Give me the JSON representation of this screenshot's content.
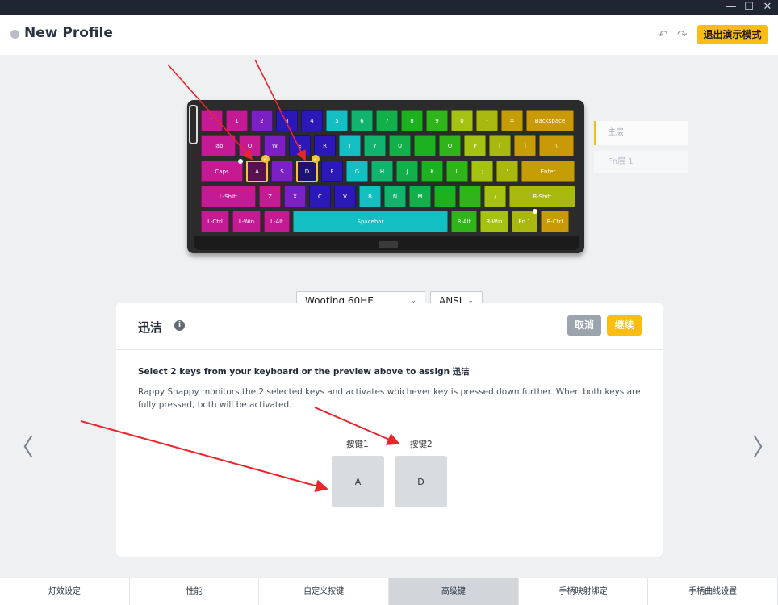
{
  "window": {
    "minimize": "—",
    "maximize": "☐",
    "close": "✕"
  },
  "header": {
    "title": "New Profile",
    "undo_icon": "↶",
    "redo_icon": "↷",
    "exit_demo_label": "退出演示模式"
  },
  "keyboard": {
    "rows": [
      [
        {
          "label": "`",
          "color": "#c41b95"
        },
        {
          "label": "1",
          "color": "#c41b95"
        },
        {
          "label": "2",
          "color": "#7a20c4"
        },
        {
          "label": "3",
          "color": "#2b18b8"
        },
        {
          "label": "4",
          "color": "#2b18b8"
        },
        {
          "label": "5",
          "color": "#14bfc4"
        },
        {
          "label": "6",
          "color": "#11b46c"
        },
        {
          "label": "7",
          "color": "#12b04a"
        },
        {
          "label": "8",
          "color": "#1cb21f"
        },
        {
          "label": "9",
          "color": "#2fb51a"
        },
        {
          "label": "0",
          "color": "#a5c213"
        },
        {
          "label": "-",
          "color": "#a8b80f"
        },
        {
          "label": "=",
          "color": "#c59d07"
        },
        {
          "label": "Backspace",
          "color": "#c99908"
        }
      ],
      [
        {
          "label": "Tab",
          "color": "#c41b95"
        },
        {
          "label": "Q",
          "color": "#c41b95"
        },
        {
          "label": "W",
          "color": "#7a20c4"
        },
        {
          "label": "E",
          "color": "#2b18b8"
        },
        {
          "label": "R",
          "color": "#2b18b8"
        },
        {
          "label": "T",
          "color": "#14bfc4"
        },
        {
          "label": "Y",
          "color": "#11b46c"
        },
        {
          "label": "U",
          "color": "#12b04a"
        },
        {
          "label": "I",
          "color": "#1cb21f"
        },
        {
          "label": "O",
          "color": "#2fb51a"
        },
        {
          "label": "P",
          "color": "#a5c213"
        },
        {
          "label": "[",
          "color": "#a8b80f"
        },
        {
          "label": "]",
          "color": "#c59d07"
        },
        {
          "label": "\\",
          "color": "#c99908"
        }
      ],
      [
        {
          "label": "Caps",
          "color": "#c41b95"
        },
        {
          "label": "A",
          "color": "#c41b95"
        },
        {
          "label": "S",
          "color": "#7a20c4"
        },
        {
          "label": "D",
          "color": "#2b18b8"
        },
        {
          "label": "F",
          "color": "#2b18b8"
        },
        {
          "label": "G",
          "color": "#14bfc4"
        },
        {
          "label": "H",
          "color": "#11b46c"
        },
        {
          "label": "J",
          "color": "#12b04a"
        },
        {
          "label": "K",
          "color": "#1cb21f"
        },
        {
          "label": "L",
          "color": "#2fb51a"
        },
        {
          "label": ";",
          "color": "#a5c213"
        },
        {
          "label": "'",
          "color": "#a8b80f"
        },
        {
          "label": "Enter",
          "color": "#c59d07"
        }
      ],
      [
        {
          "label": "L-Shift",
          "color": "#c41b95"
        },
        {
          "label": "Z",
          "color": "#c41b95"
        },
        {
          "label": "X",
          "color": "#7a20c4"
        },
        {
          "label": "C",
          "color": "#2b18b8"
        },
        {
          "label": "V",
          "color": "#2b18b8"
        },
        {
          "label": "B",
          "color": "#14bfc4"
        },
        {
          "label": "N",
          "color": "#11b46c"
        },
        {
          "label": "M",
          "color": "#12b04a"
        },
        {
          "label": ",",
          "color": "#1cb21f"
        },
        {
          "label": ".",
          "color": "#2fb51a"
        },
        {
          "label": "/",
          "color": "#a5c213"
        },
        {
          "label": "R-Shift",
          "color": "#a8b80f"
        }
      ],
      [
        {
          "label": "L-Ctrl",
          "color": "#c41b95"
        },
        {
          "label": "L-Win",
          "color": "#c41b95"
        },
        {
          "label": "L-Alt",
          "color": "#c41b95"
        },
        {
          "label": "Spacebar",
          "color": "#14bfc4"
        },
        {
          "label": "R-Alt",
          "color": "#2fb51a"
        },
        {
          "label": "R-Win",
          "color": "#a5c213"
        },
        {
          "label": "Fn 1",
          "color": "#a8b80f"
        },
        {
          "label": "R-Ctrl",
          "color": "#c99908"
        }
      ]
    ],
    "selected_keys": [
      "A",
      "D"
    ]
  },
  "layers": {
    "main": "主层",
    "fn": "Fn层 1"
  },
  "selectors": {
    "model": "Wooting 60HE",
    "layout": "ANSI"
  },
  "panel": {
    "title": "迅洁",
    "cancel": "取消",
    "continue": "继续",
    "instruction": "Select 2 keys from your keyboard or the preview above to assign 迅洁",
    "description": "Rappy Snappy monitors the 2 selected keys and activates whichever key is pressed down further. When both keys are fully pressed, both will be activated.",
    "slot1_label": "按键1",
    "slot2_label": "按键2",
    "slot1_value": "A",
    "slot2_value": "D"
  },
  "nav": {
    "prev": "〈",
    "next": "〉"
  },
  "bottom_tabs": [
    "灯效设定",
    "性能",
    "自定义按键",
    "高级键",
    "手柄映射绑定",
    "手柄曲线设置"
  ],
  "active_tab": "高级键",
  "colors": {
    "accent": "#fbbd14",
    "annotation": "#e8262d"
  }
}
